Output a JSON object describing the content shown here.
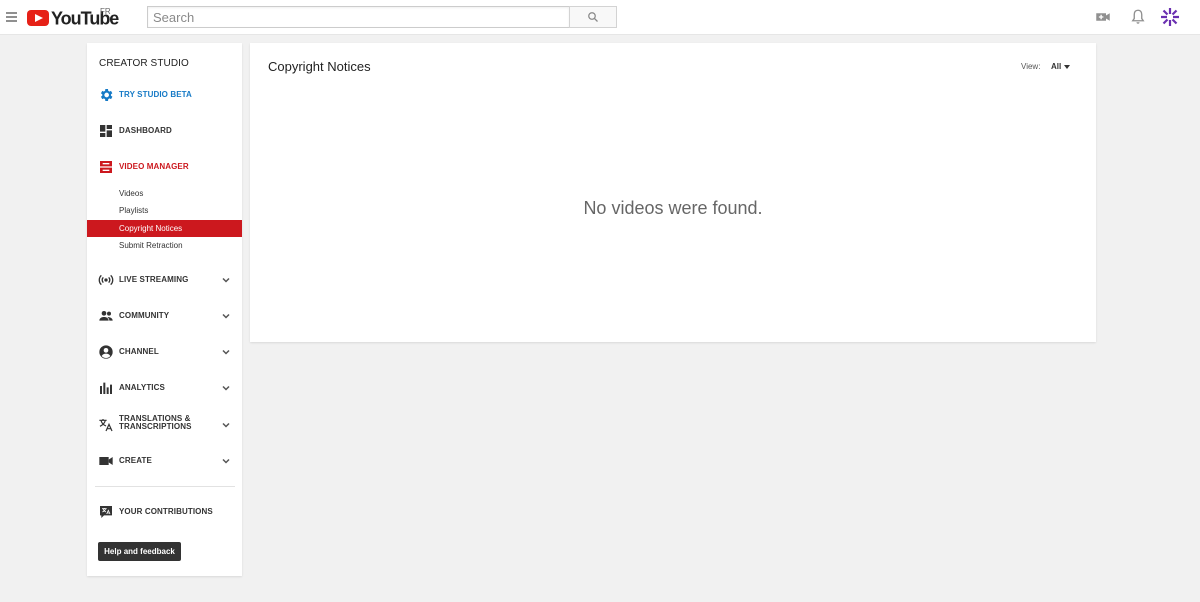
{
  "header": {
    "logo_text": "YouTube",
    "region": "FR",
    "search_placeholder": "Search",
    "icons": [
      "menu-icon",
      "search-icon",
      "upload-video-icon",
      "notifications-bell-icon",
      "avatar"
    ]
  },
  "sidebar": {
    "title": "CREATOR STUDIO",
    "items": [
      {
        "label": "TRY STUDIO BETA",
        "icon": "gear-icon"
      },
      {
        "label": "DASHBOARD",
        "icon": "dashboard-icon"
      },
      {
        "label": "VIDEO MANAGER",
        "icon": "video-manager-icon"
      },
      {
        "label": "LIVE STREAMING",
        "icon": "live-streaming-icon"
      },
      {
        "label": "COMMUNITY",
        "icon": "community-icon"
      },
      {
        "label": "CHANNEL",
        "icon": "channel-icon"
      },
      {
        "label": "ANALYTICS",
        "icon": "analytics-icon"
      },
      {
        "label": "TRANSLATIONS &\nTRANSCRIPTIONS",
        "label_line1": "TRANSLATIONS &",
        "label_line2": "TRANSCRIPTIONS",
        "icon": "translate-icon"
      },
      {
        "label": "CREATE",
        "icon": "camera-icon"
      }
    ],
    "video_manager_sub": [
      {
        "label": "Videos"
      },
      {
        "label": "Playlists"
      },
      {
        "label": "Copyright Notices",
        "selected": true
      },
      {
        "label": "Submit Retraction"
      }
    ],
    "contributions_label": "YOUR CONTRIBUTIONS",
    "help_label": "Help and feedback"
  },
  "main": {
    "title": "Copyright Notices",
    "view_label": "View:",
    "view_value": "All",
    "empty_message": "No videos were found."
  },
  "colors": {
    "accent_red": "#cc181e",
    "link_blue": "#167ac6",
    "logo_red": "#e62117"
  }
}
